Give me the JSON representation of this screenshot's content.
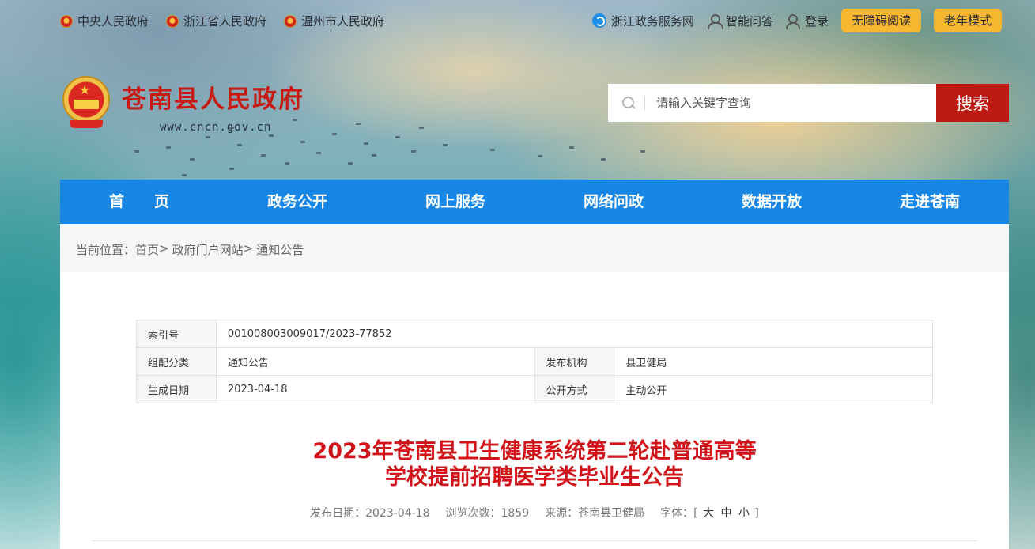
{
  "topbar": {
    "gov_links": [
      "中央人民政府",
      "浙江省人民政府",
      "温州市人民政府"
    ],
    "service_link": "浙江政务服务网",
    "qa_link": "智能问答",
    "login_link": "登录",
    "accessibility_btn": "无障碍阅读",
    "elder_btn": "老年模式"
  },
  "header": {
    "site_title": "苍南县人民政府",
    "site_url": "www.cncn.gov.cn"
  },
  "search": {
    "placeholder": "请输入关键字查询",
    "button": "搜索"
  },
  "nav": {
    "items": [
      "首　　页",
      "政务公开",
      "网上服务",
      "网络问政",
      "数据开放",
      "走进苍南"
    ]
  },
  "breadcrumb": {
    "prefix": "当前位置：",
    "items": [
      "首页",
      "政府门户网站",
      "通知公告"
    ],
    "separator": ">"
  },
  "meta": {
    "index_label": "索引号",
    "index_value": "001008003009017/2023-77852",
    "category_label": "组配分类",
    "category_value": "通知公告",
    "org_label": "发布机构",
    "org_value": "县卫健局",
    "date_label": "生成日期",
    "date_value": "2023-04-18",
    "open_label": "公开方式",
    "open_value": "主动公开"
  },
  "article": {
    "title_line1": "2023年苍南县卫生健康系统第二轮赴普通高等",
    "title_line2": "学校提前招聘医学类毕业生公告",
    "publish": "发布日期：2023-04-18",
    "views": "浏览次数：1859",
    "source": "来源：苍南县卫健局",
    "font_label": "字体：[",
    "font_large": "大",
    "font_medium": "中",
    "font_small": "小",
    "font_close": "]"
  },
  "colors": {
    "nav_blue": "#1786e4",
    "title_red": "#d0141a",
    "search_red": "#bd1a14",
    "button_yellow": "#f7b731"
  }
}
